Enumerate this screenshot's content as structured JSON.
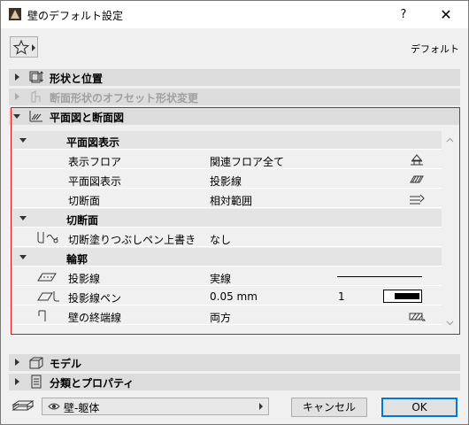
{
  "window": {
    "title": "壁のデフォルト設定",
    "help": "?",
    "close": "✕"
  },
  "header": {
    "default_label": "デフォルト",
    "favorites_icon": "star-icon"
  },
  "panels": [
    {
      "label": "形状と位置",
      "expanded": false,
      "enabled": true
    },
    {
      "label": "断面形状のオフセット形状変更",
      "expanded": false,
      "enabled": false
    },
    {
      "label": "平面図と断面図",
      "expanded": true,
      "enabled": true
    },
    {
      "label": "モデル",
      "expanded": false,
      "enabled": true
    },
    {
      "label": "分類とプロパティ",
      "expanded": false,
      "enabled": true
    }
  ],
  "tree": {
    "groups": [
      {
        "label": "平面図表示"
      },
      {
        "label": "切断面"
      },
      {
        "label": "輪郭"
      }
    ],
    "items": [
      {
        "label": "表示フロア",
        "value": "関連フロア全て"
      },
      {
        "label": "平面図表示",
        "value": "投影線"
      },
      {
        "label": "切断面",
        "value": "相対範囲"
      },
      {
        "label": "切断塗りつぶしペン上書き",
        "value": "なし"
      },
      {
        "label": "投影線",
        "value": "実線"
      },
      {
        "label": "投影線ペン",
        "value": "0.05 mm",
        "pen_number": "1"
      },
      {
        "label": "壁の終端線",
        "value": "両方"
      }
    ]
  },
  "footer": {
    "layer_value": "壁-躯体",
    "cancel_label": "キャンセル",
    "ok_label": "OK"
  },
  "colors": {
    "highlight_border": "#e81010",
    "ok_border": "#0078d7"
  }
}
